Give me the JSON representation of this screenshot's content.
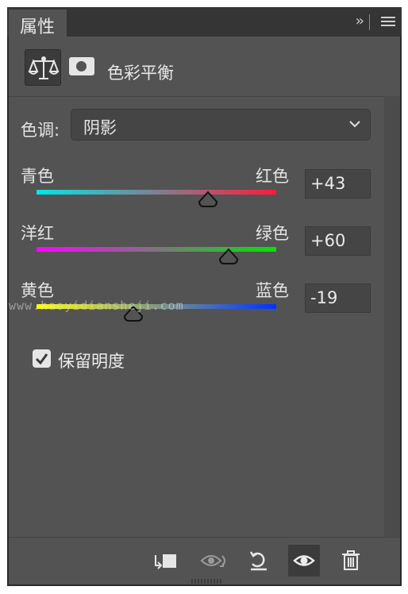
{
  "tab": {
    "title": "属性"
  },
  "toolbar": {
    "collapse_glyph": "›› ",
    "menu_icon": "menu-icon"
  },
  "header": {
    "title": "色彩平衡",
    "adjust_icon": "balance-scale-icon",
    "mask_icon": "mask-icon"
  },
  "tone": {
    "label": "色调:",
    "value": "阴影"
  },
  "sliders": [
    {
      "left": "青色",
      "right": "红色",
      "value": "+43",
      "level": 43,
      "colors": [
        "#00e6e6",
        "#ff1a3c"
      ]
    },
    {
      "left": "洋红",
      "right": "绿色",
      "value": "+60",
      "level": 60,
      "colors": [
        "#ff00ff",
        "#00e600"
      ]
    },
    {
      "left": "黄色",
      "right": "蓝色",
      "value": "-19",
      "level": -19,
      "colors": [
        "#ffff00",
        "#0033ff"
      ]
    }
  ],
  "watermark": "www.haoyidiansheji.com",
  "preserve": {
    "label": "保留明度",
    "checked": true
  },
  "footer": {
    "buttons": [
      "clip-to-layer-icon",
      "view-previous-icon",
      "reset-icon",
      "visibility-eye-icon",
      "trash-icon"
    ]
  }
}
